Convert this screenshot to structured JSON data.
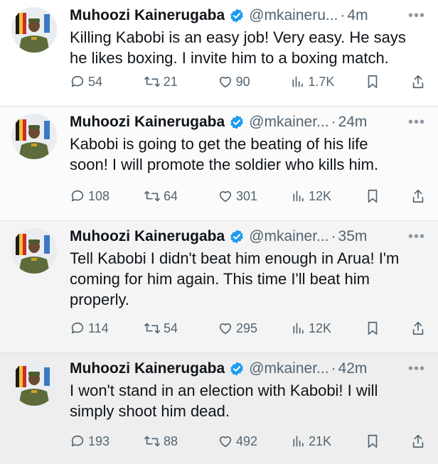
{
  "tweets": [
    {
      "name": "Muhoozi Kainerugaba",
      "handle": "@mkaineru...",
      "separator": "·",
      "time": "4m",
      "text": "Killing Kabobi is an easy job! Very easy. He says\nhe likes boxing. I invite him to a boxing match.",
      "replies": "54",
      "retweets": "21",
      "likes": "90",
      "views": "1.7K"
    },
    {
      "name": "Muhoozi Kainerugaba",
      "handle": "@mkainer...",
      "separator": "·",
      "time": "24m",
      "text": "Kabobi is going to get the beating of his life\nsoon! I will promote the soldier who kills him.",
      "replies": "108",
      "retweets": "64",
      "likes": "301",
      "views": "12K"
    },
    {
      "name": "Muhoozi Kainerugaba",
      "handle": "@mkainer...",
      "separator": "·",
      "time": "35m",
      "text": "Tell Kabobi I didn't beat him enough in Arua! I'm\ncoming for him again. This time I'll beat him\nproperly.",
      "replies": "114",
      "retweets": "54",
      "likes": "295",
      "views": "12K"
    },
    {
      "name": "Muhoozi Kainerugaba",
      "handle": "@mkainer...",
      "separator": "·",
      "time": "42m",
      "text": "I won't stand in an election with Kabobi! I will\nsimply shoot him dead.",
      "replies": "193",
      "retweets": "88",
      "likes": "492",
      "views": "21K"
    }
  ],
  "colors": {
    "verified": "#1d9bf0",
    "text": "#0f1419",
    "secondary": "#536471"
  }
}
